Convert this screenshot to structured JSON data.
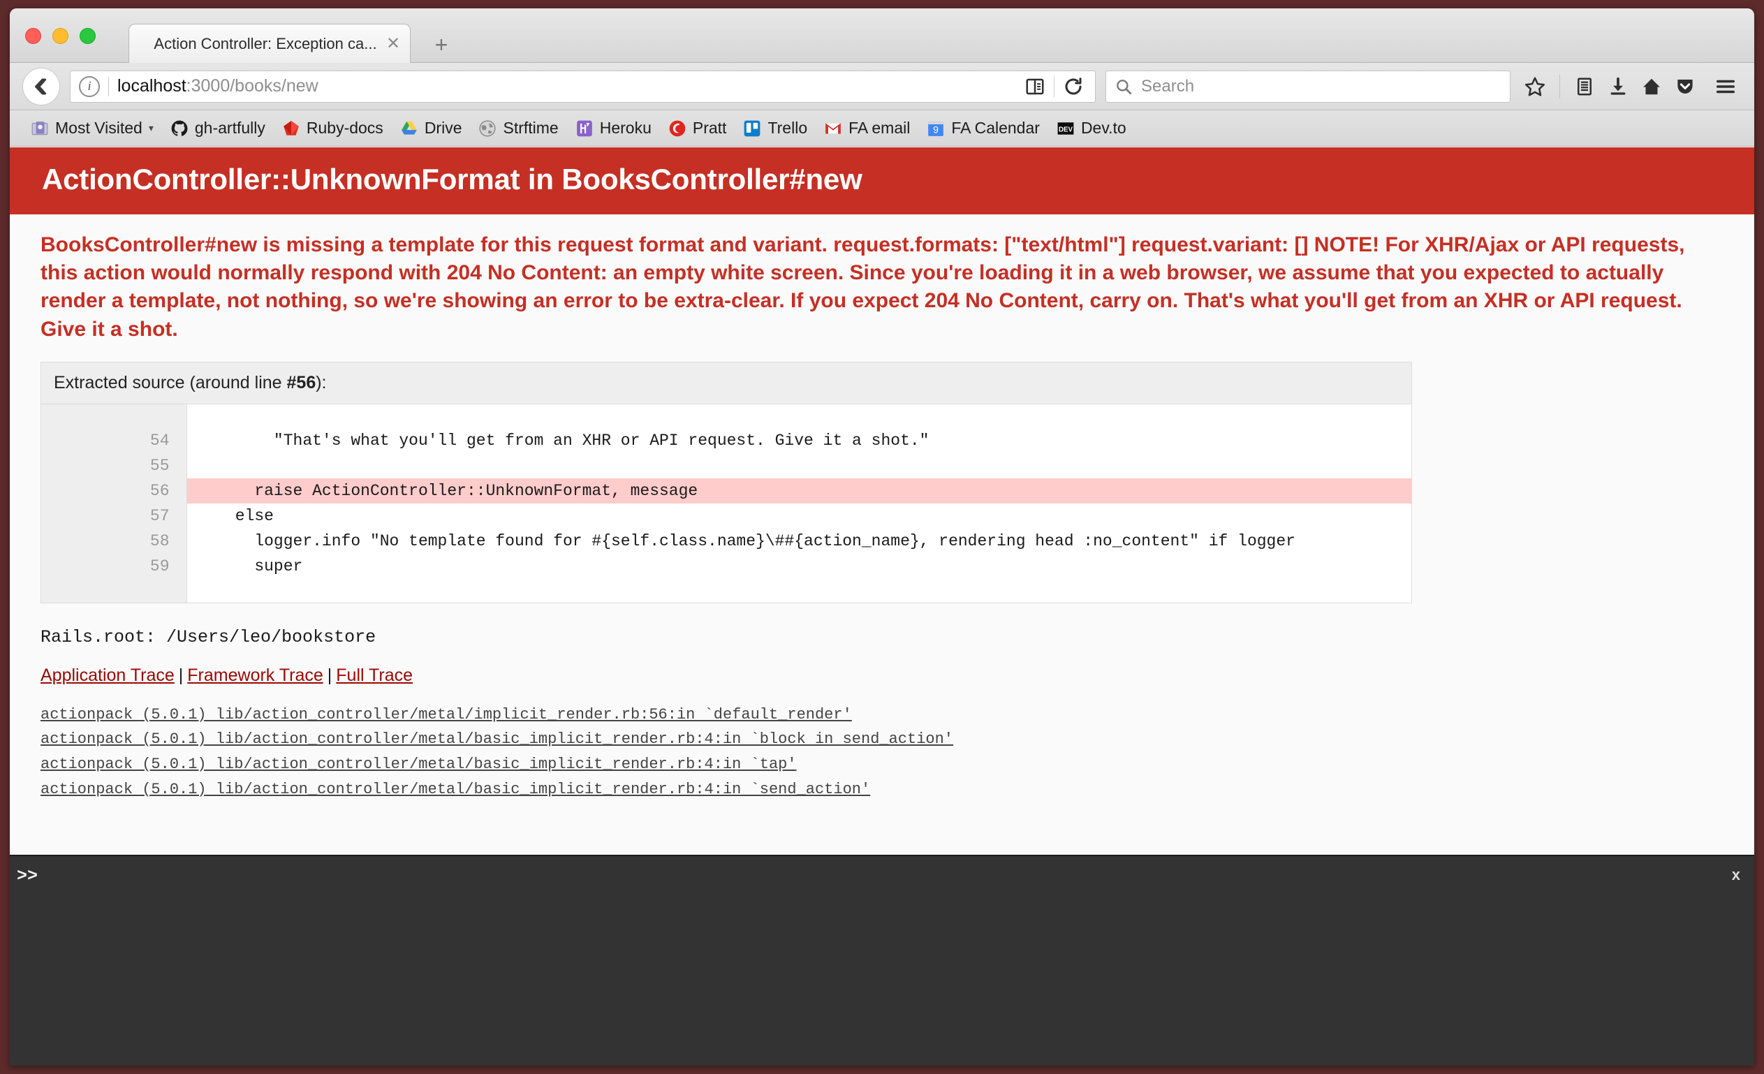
{
  "window": {
    "traffic_lights": [
      "close",
      "minimize",
      "maximize"
    ]
  },
  "tabbar": {
    "tab_title": "Action Controller: Exception ca...",
    "close_glyph": "✕",
    "new_tab_glyph": "+"
  },
  "toolbar": {
    "url_host": "localhost",
    "url_path": ":3000/books/new",
    "search_placeholder": "Search",
    "icons": [
      "back-icon",
      "identity-info-icon",
      "reader-mode-icon",
      "reload-icon",
      "search-icon",
      "bookmark-star-icon",
      "library-icon",
      "downloads-icon",
      "home-icon",
      "pocket-icon",
      "hamburger-menu-icon"
    ]
  },
  "bookmarks": [
    {
      "label": "Most Visited",
      "icon": "folder-star-icon",
      "caret": "▾"
    },
    {
      "label": "gh-artfully",
      "icon": "github-icon",
      "caret": ""
    },
    {
      "label": "Ruby-docs",
      "icon": "ruby-icon",
      "caret": ""
    },
    {
      "label": "Drive",
      "icon": "google-drive-icon",
      "caret": ""
    },
    {
      "label": "Strftime",
      "icon": "globe-icon",
      "caret": ""
    },
    {
      "label": "Heroku",
      "icon": "heroku-icon",
      "caret": ""
    },
    {
      "label": "Pratt",
      "icon": "pratt-icon",
      "caret": ""
    },
    {
      "label": "Trello",
      "icon": "trello-icon",
      "caret": ""
    },
    {
      "label": "FA email",
      "icon": "gmail-icon",
      "caret": ""
    },
    {
      "label": "FA Calendar",
      "icon": "google-calendar-icon",
      "caret": ""
    },
    {
      "label": "Dev.to",
      "icon": "devto-icon",
      "caret": ""
    }
  ],
  "page": {
    "error_title": "ActionController::UnknownFormat in BooksController#new",
    "error_message": "BooksController#new is missing a template for this request format and variant. request.formats: [\"text/html\"] request.variant: [] NOTE! For XHR/Ajax or API requests, this action would normally respond with 204 No Content: an empty white screen. Since you're loading it in a web browser, we assume that you expected to actually render a template, not nothing, so we're showing an error to be extra-clear. If you expect 204 No Content, carry on. That's what you'll get from an XHR or API request. Give it a shot.",
    "source": {
      "header_prefix": "Extracted source (around line ",
      "header_line": "#56",
      "header_suffix": "):",
      "lines": [
        {
          "num": "54",
          "code": "        \"That's what you'll get from an XHR or API request. Give it a shot.\"",
          "highlight": false
        },
        {
          "num": "55",
          "code": "",
          "highlight": false
        },
        {
          "num": "56",
          "code": "      raise ActionController::UnknownFormat, message",
          "highlight": true
        },
        {
          "num": "57",
          "code": "    else",
          "highlight": false
        },
        {
          "num": "58",
          "code": "      logger.info \"No template found for #{self.class.name}\\##{action_name}, rendering head :no_content\" if logger",
          "highlight": false
        },
        {
          "num": "59",
          "code": "      super",
          "highlight": false
        }
      ]
    },
    "rails_root": "Rails.root: /Users/leo/bookstore",
    "trace_links": [
      {
        "label": "Application Trace"
      },
      {
        "label": "Framework Trace"
      },
      {
        "label": "Full Trace"
      }
    ],
    "trace_separator": "|",
    "trace_lines": [
      "actionpack (5.0.1) lib/action_controller/metal/implicit_render.rb:56:in `default_render'",
      "actionpack (5.0.1) lib/action_controller/metal/basic_implicit_render.rb:4:in `block in send_action'",
      "actionpack (5.0.1) lib/action_controller/metal/basic_implicit_render.rb:4:in `tap'",
      "actionpack (5.0.1) lib/action_controller/metal/basic_implicit_render.rb:4:in `send_action'"
    ]
  },
  "console": {
    "prompt": ">>",
    "close_label": "x"
  },
  "colors": {
    "rails_red": "#C52F24",
    "highlight_pink": "#ffcccc",
    "link_red": "#980905",
    "console_bg": "#333333"
  }
}
